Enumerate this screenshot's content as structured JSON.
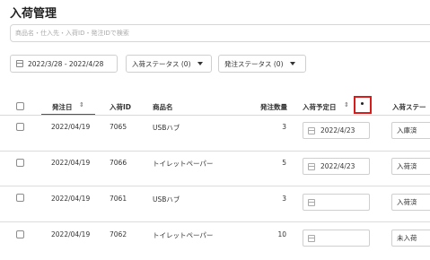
{
  "page": {
    "title": "入荷管理"
  },
  "search": {
    "placeholder": "商品名・仕入先・入荷ID・発注IDで検索"
  },
  "filters": {
    "date_range": "2022/3/28 - 2022/4/28",
    "arrival_status": "入荷ステータス (0)",
    "order_status": "発注ステータス (0)"
  },
  "columns": {
    "order_date": "発注日",
    "arrival_id": "入荷ID",
    "product": "商品名",
    "qty": "発注数量",
    "planned_date": "入荷予定日",
    "status": "入荷ステー"
  },
  "rows": [
    {
      "order_date": "2022/04/19",
      "arrival_id": "7065",
      "product": "USBハブ",
      "qty": "3",
      "planned_date": "2022/4/23",
      "status": "入庫済"
    },
    {
      "order_date": "2022/04/19",
      "arrival_id": "7066",
      "product": "トイレットペーパー",
      "qty": "5",
      "planned_date": "2022/4/23",
      "status": "入荷済"
    },
    {
      "order_date": "2022/04/19",
      "arrival_id": "7061",
      "product": "USBハブ",
      "qty": "3",
      "planned_date": "",
      "status": "入荷済"
    },
    {
      "order_date": "2022/04/19",
      "arrival_id": "7062",
      "product": "トイレットペーパー",
      "qty": "10",
      "planned_date": "",
      "status": "未入荷"
    }
  ],
  "colors": {
    "highlight": "#d81b1b",
    "border": "#cfcfcf"
  },
  "icons": {
    "sort": "sort-arrows-icon",
    "calendar": "calendar-icon",
    "caret": "caret-down-icon"
  }
}
